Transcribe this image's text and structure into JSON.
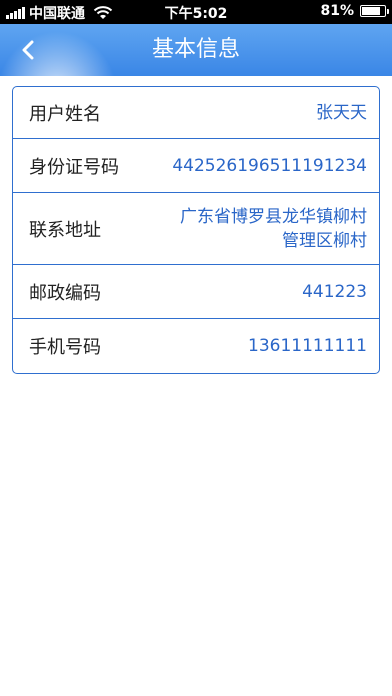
{
  "status_bar": {
    "carrier": "中国联通",
    "time": "下午5:02",
    "battery_percent": "81%",
    "battery_level": 0.81
  },
  "nav": {
    "title": "基本信息",
    "back_icon": "chevron-left-icon"
  },
  "info": {
    "name": {
      "label": "用户姓名",
      "value": "张天天"
    },
    "id_number": {
      "label": "身份证号码",
      "value": "442526196511191234"
    },
    "address": {
      "label": "联系地址",
      "value_line1": "广东省博罗县龙华镇柳村",
      "value_line2": "管理区柳村"
    },
    "postcode": {
      "label": "邮政编码",
      "value": "441223"
    },
    "phone": {
      "label": "手机号码",
      "value": "13611111111"
    }
  },
  "colors": {
    "nav_bar": "#3a86e6",
    "accent_text": "#2a66c8",
    "border": "#2f6fcf"
  }
}
